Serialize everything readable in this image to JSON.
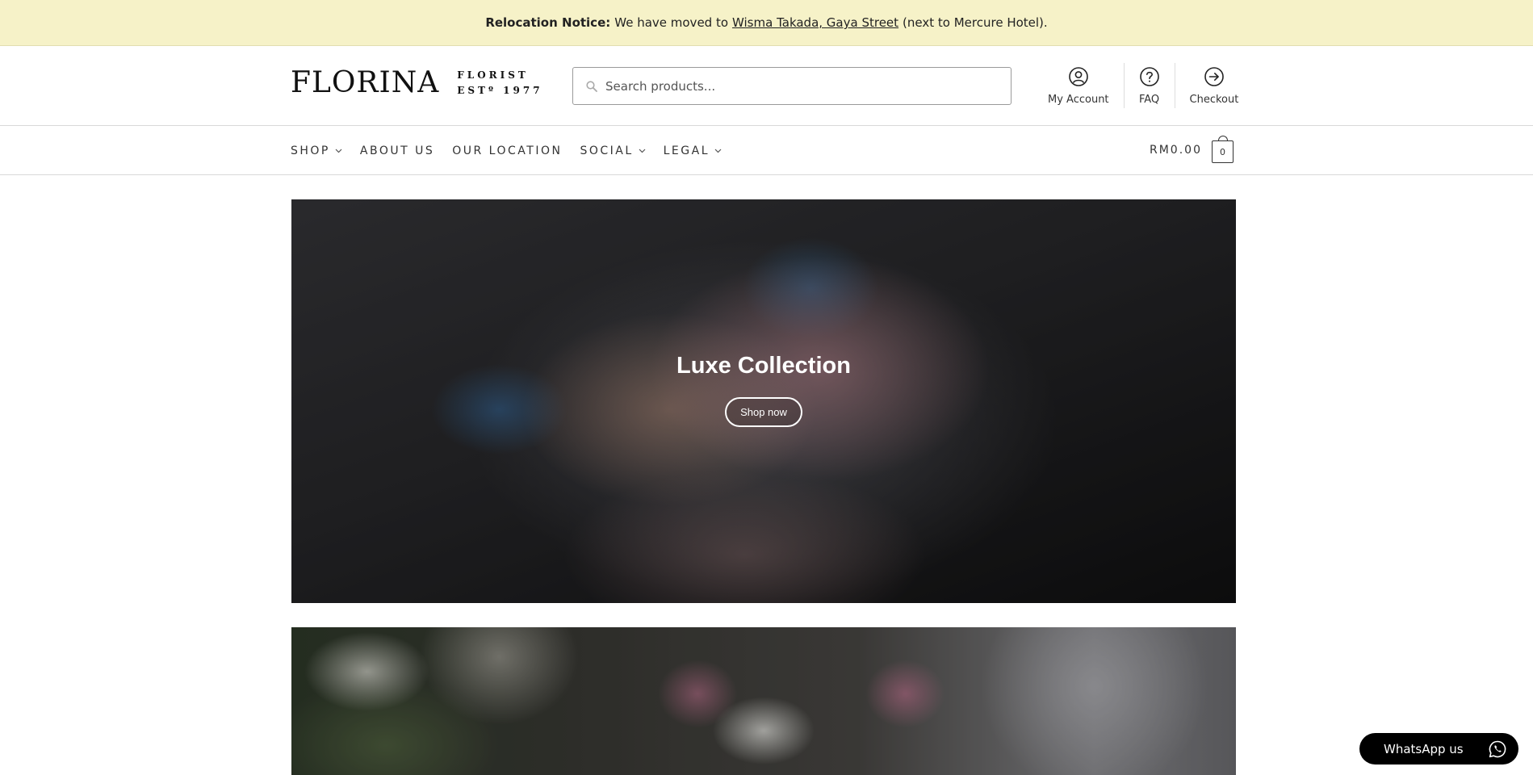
{
  "notice": {
    "label": "Relocation Notice:",
    "text_before": "We have moved to",
    "link": "Wisma Takada, Gaya Street",
    "text_after": "(next to Mercure Hotel)."
  },
  "header": {
    "logo_word": "FLORINA",
    "logo_line1": "FLORIST",
    "logo_line2": "ESTº 1977",
    "search_placeholder": "Search products...",
    "links": [
      {
        "label": "My Account",
        "icon": "user-circle-icon"
      },
      {
        "label": "FAQ",
        "icon": "question-circle-icon"
      },
      {
        "label": "Checkout",
        "icon": "arrow-right-circle-icon"
      }
    ]
  },
  "nav": {
    "items": [
      {
        "label": "SHOP",
        "dropdown": true
      },
      {
        "label": "ABOUT US",
        "dropdown": false
      },
      {
        "label": "OUR LOCATION",
        "dropdown": false
      },
      {
        "label": "SOCIAL",
        "dropdown": true
      },
      {
        "label": "LEGAL",
        "dropdown": true
      }
    ],
    "cart_total": "RM0.00",
    "cart_count": "0"
  },
  "hero": {
    "title": "Luxe Collection",
    "button": "Shop now"
  },
  "whatsapp": {
    "label": "WhatsApp us",
    "icon": "whatsapp-icon"
  },
  "colors": {
    "notice_bg": "#f6f2c8",
    "text": "#222222",
    "whatsapp_bg": "#000000"
  }
}
